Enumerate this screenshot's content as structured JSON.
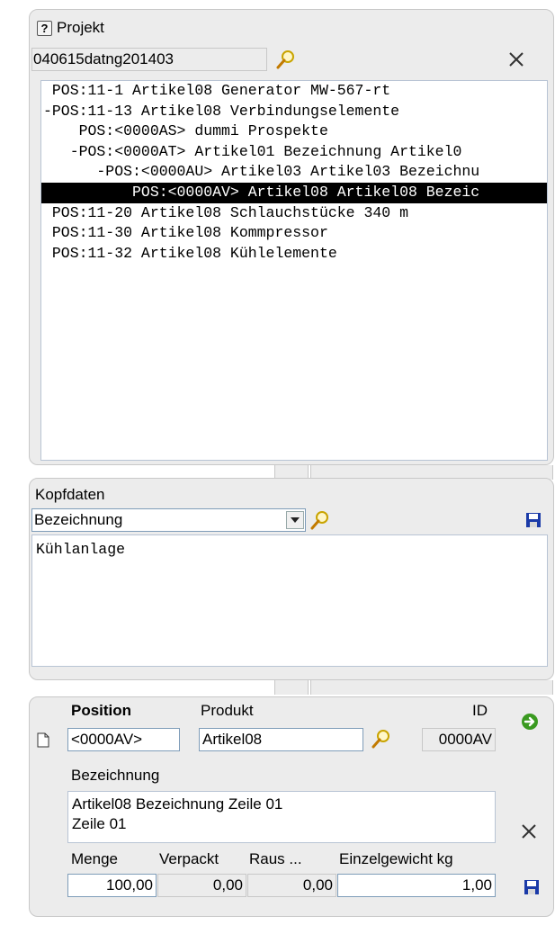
{
  "projekt": {
    "title": "Projekt",
    "project_number": "040615datng201403",
    "tree": [
      {
        "text": " POS:11-1 Artikel08 Generator MW-567-rt",
        "selected": false
      },
      {
        "text": "-POS:11-13 Artikel08 Verbindungselemente",
        "selected": false
      },
      {
        "text": "    POS:<0000AS> dummi Prospekte",
        "selected": false
      },
      {
        "text": "   -POS:<0000AT> Artikel01 Bezeichnung Artikel0",
        "selected": false
      },
      {
        "text": "      -POS:<0000AU> Artikel03 Artikel03 Bezeichnu",
        "selected": false
      },
      {
        "text": "          POS:<0000AV> Artikel08 Artikel08 Bezeic",
        "selected": true
      },
      {
        "text": " POS:11-20 Artikel08 Schlauchstücke 340 m",
        "selected": false
      },
      {
        "text": " POS:11-30 Artikel08 Kommpressor",
        "selected": false
      },
      {
        "text": " POS:11-32 Artikel08 Kühlelemente",
        "selected": false
      }
    ]
  },
  "kopfdaten": {
    "title": "Kopfdaten",
    "select_value": "Bezeichnung",
    "text": "Kühlanlage"
  },
  "position": {
    "position_label": "Position",
    "produkt_label": "Produkt",
    "id_label": "ID",
    "position_value": "<0000AV>",
    "produkt_value": "Artikel08",
    "id_value": "0000AV",
    "bezeichnung_label": "Bezeichnung",
    "bezeichnung_text": "Artikel08 Bezeichnung Zeile 01\nZeile 01",
    "menge_label": "Menge",
    "verpackt_label": "Verpackt",
    "raus_label": "Raus ...",
    "gewicht_label": "Einzelgewicht kg",
    "menge_value": "100,00",
    "verpackt_value": "0,00",
    "raus_value": "0,00",
    "gewicht_value": "1,00"
  },
  "colors": {
    "panel_bg": "#ececec",
    "selection_bg": "#000000",
    "save_icon": "#1a3aa8",
    "go_icon": "#3a9a20"
  }
}
